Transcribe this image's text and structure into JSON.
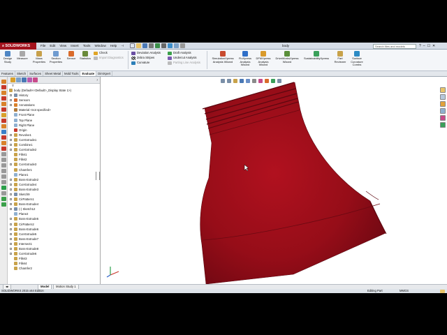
{
  "app": {
    "logo": "SOLIDWORKS",
    "doc_title": "body"
  },
  "menus": [
    "File",
    "Edit",
    "View",
    "Insert",
    "Tools",
    "Window",
    "Help"
  ],
  "search": {
    "placeholder": "Search files and models"
  },
  "window_controls": [
    "?",
    "–",
    "☐",
    "✕"
  ],
  "ribbon": {
    "design_study": "Design Study",
    "measure": "Measure",
    "mass_properties": "Mass Properties",
    "section_properties": "Section Properties",
    "sensor": "Sensor",
    "statistics": "Statistics",
    "check": "Check",
    "import_diagnostics": "Import Diagnostics",
    "deviation_analysis": "Deviation Analysis",
    "zebra_stripes": "Zebra Stripes",
    "curvature": "Curvature",
    "draft_analysis": "Draft Analysis",
    "undercut_analysis": "Undercut Analysis",
    "parting_line_analysis": "Parting Line Analysis",
    "simulationxpress": "SimulationXpress Analysis Wizard",
    "floxpress": "FloXpress Analysis Wizard",
    "dfmxpress": "DFMXpress Analysis Wizard",
    "driveworksxpress": "DriveWorksXpress Wizard",
    "sustainabilityxpress": "SustainabilityXpress",
    "part_reviewer": "Part Reviewer",
    "surface_curvature_combs": "Surface Curvature Combs"
  },
  "command_tabs": [
    "Features",
    "Sketch",
    "Surfaces",
    "Sheet Metal",
    "Mold Tools",
    "Evaluate",
    "DimXpert"
  ],
  "active_tab": "Evaluate",
  "feature_tree": [
    "body  (Default<<Default>_Display State 1>)",
    "History",
    "Sensors",
    "Annotations",
    "Material <not specified>",
    "Front Plane",
    "Top Plane",
    "Right Plane",
    "Origin",
    "Revolve1",
    "Cut-Extrude1",
    "Combine1",
    "Cut-Extrude2",
    "Fillet1",
    "Fillet2",
    "Cut-Extrude3",
    "Chamfer1",
    "Plane1",
    "Boss-Extrude2",
    "Cut-Extrude4",
    "Boss-Extrude3",
    "Sketch9",
    "CirPattern1",
    "Boss-Extrude4",
    "(-) Sketch12",
    "Plane2",
    "Boss-Extrude5",
    "CirPattern2",
    "Boss-Extrude6",
    "Cut-Extrude5",
    "Boss-Extrude7",
    "Intersect1",
    "Boss-Extrude8",
    "Cut-Extrude6",
    "Fillet3",
    "Fillet4",
    "Chamfer2"
  ],
  "bottom_tabs": [
    "Model",
    "Motion Study 1"
  ],
  "status": {
    "edition": "SOLIDWORKS 2015 x64 Edition",
    "mode": "Editing Part",
    "units": "MMGS"
  },
  "colors": {
    "model_red": "#9b0d17",
    "brand_red": "#a3121d"
  }
}
